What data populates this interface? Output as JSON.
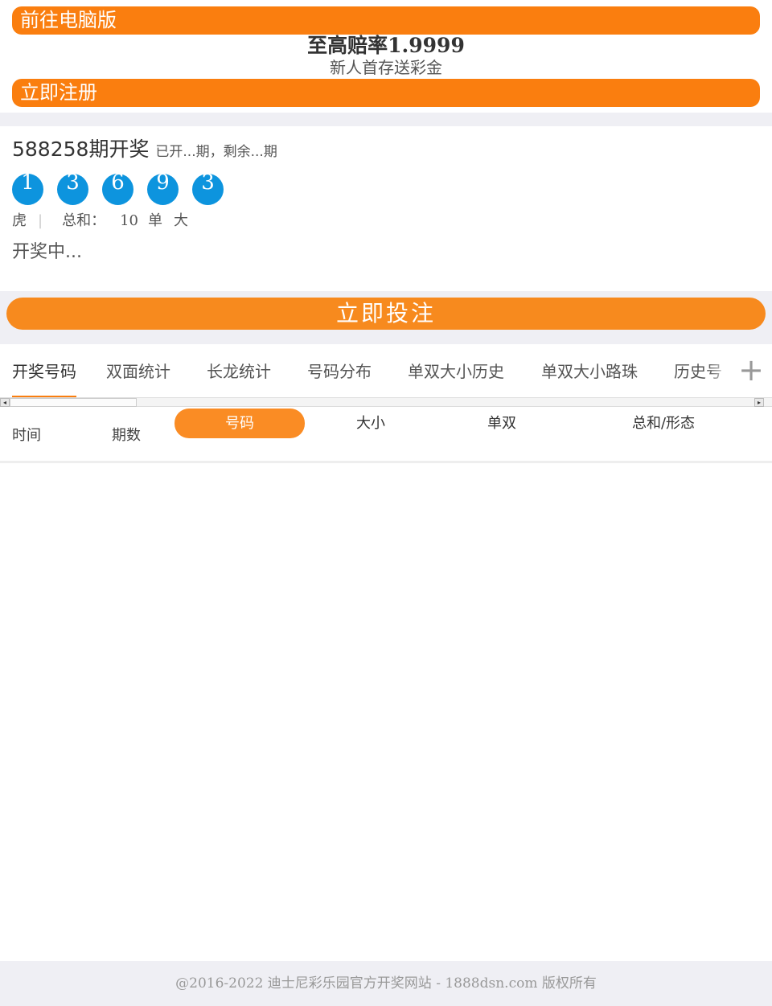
{
  "header": {
    "pc_link_label": "前往电脑版",
    "promo_title": "至高赔率1.9999",
    "promo_subtitle": "新人首存送彩金",
    "register_label": "立即注册"
  },
  "draw": {
    "period": "588258",
    "period_suffix": "期开奖",
    "status_text": "已开...期，剩余...期",
    "balls": [
      "1",
      "3",
      "6",
      "9",
      "3"
    ],
    "dragon_tiger": "虎",
    "divider": "|",
    "sum_label": "总和：",
    "sum_value": "10",
    "odd_even": "单",
    "big_small": "大",
    "drawing_text": "开奖中..."
  },
  "bet_button_label": "立即投注",
  "tabs": [
    {
      "label": "开奖号码",
      "active": true
    },
    {
      "label": "双面统计",
      "active": false
    },
    {
      "label": "长龙统计",
      "active": false
    },
    {
      "label": "号码分布",
      "active": false
    },
    {
      "label": "单双大小历史",
      "active": false
    },
    {
      "label": "单双大小路珠",
      "active": false
    },
    {
      "label": "历史号",
      "active": false
    }
  ],
  "tab_more_icon": "plus-icon",
  "table": {
    "col_time": "时间",
    "col_period": "期数",
    "toggles": [
      {
        "label": "号码",
        "active": true
      },
      {
        "label": "大小",
        "active": false
      },
      {
        "label": "单双",
        "active": false
      },
      {
        "label": "总和/形态",
        "active": false
      }
    ]
  },
  "colors": {
    "accent_orange": "#fa7e0f",
    "ball_blue": "#0d94de",
    "gray_bg": "#efeff4"
  },
  "footer_text": "@2016-2022 迪士尼彩乐园官方开奖网站 - 1888dsn.com 版权所有"
}
